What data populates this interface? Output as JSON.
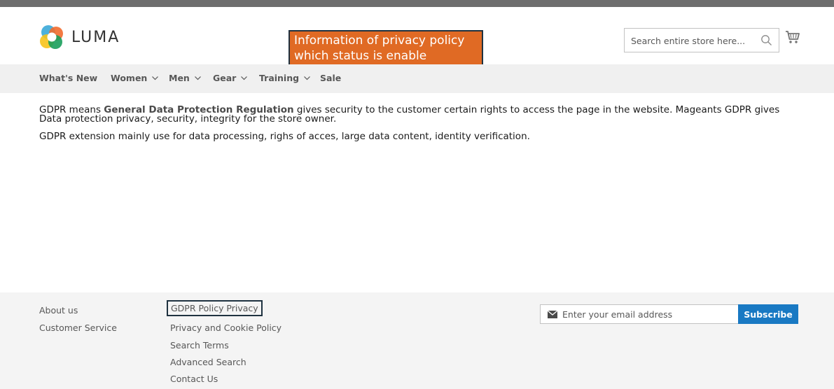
{
  "brand": {
    "name": "LUMA"
  },
  "annotation": {
    "line1": "Information of privacy policy",
    "line2": "which status is enable"
  },
  "search": {
    "placeholder": "Search entire store here..."
  },
  "nav": [
    {
      "label": "What's New",
      "has_dropdown": false
    },
    {
      "label": "Women",
      "has_dropdown": true
    },
    {
      "label": "Men",
      "has_dropdown": true
    },
    {
      "label": "Gear",
      "has_dropdown": true
    },
    {
      "label": "Training",
      "has_dropdown": true
    },
    {
      "label": "Sale",
      "has_dropdown": false
    }
  ],
  "content": {
    "p1_prefix": "GDPR means ",
    "p1_bold": "General Data Protection Regulation",
    "p1_rest": " gives security to the customer certain rights to access the page in the website. Mageants GDPR gives Data protection privacy, security, integrity for the store owner.",
    "p2": "GDPR extension mainly use for data processing, righs of acces, large data content, identity verification."
  },
  "footer": {
    "col1": [
      "About us",
      "Customer Service"
    ],
    "col2": [
      "GDPR Policy Privacy",
      "Privacy and Cookie Policy",
      "Search Terms",
      "Advanced Search",
      "Contact Us"
    ],
    "newsletter": {
      "placeholder": "Enter your email address",
      "button": "Subscribe"
    }
  },
  "colors": {
    "top_bar": "#6e6e6e",
    "callout_bg": "#e06a24",
    "highlight_border": "#1f3240",
    "subscribe_bg": "#1979c3",
    "nav_bg": "#f0f0f0",
    "footer_bg": "#f4f4f4"
  },
  "icons": {
    "logo": "luma-logo-icon",
    "search": "search-icon",
    "cart": "cart-icon",
    "chevron": "chevron-down-icon",
    "mail": "mail-icon"
  }
}
